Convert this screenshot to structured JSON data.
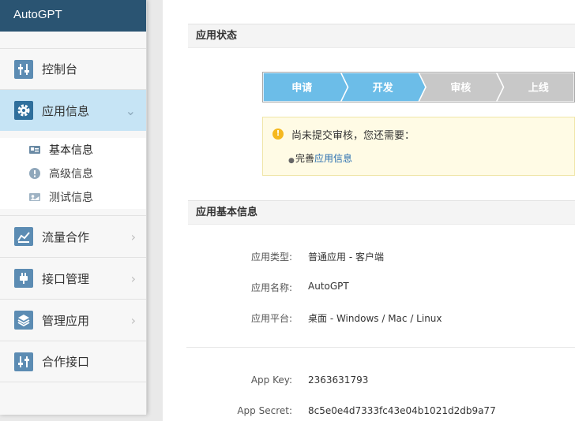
{
  "sidebar": {
    "brand": "AutoGPT",
    "items": [
      {
        "label": "控制台",
        "icon": "console-icon"
      },
      {
        "label": "应用信息",
        "icon": "gear-icon",
        "expanded": true
      },
      {
        "label": "流量合作",
        "icon": "chart-icon"
      },
      {
        "label": "接口管理",
        "icon": "plug-icon"
      },
      {
        "label": "管理应用",
        "icon": "layers-icon"
      },
      {
        "label": "合作接口",
        "icon": "sliders-icon"
      }
    ],
    "subitems": [
      {
        "label": "基本信息",
        "icon": "id-card-icon"
      },
      {
        "label": "高级信息",
        "icon": "info-icon"
      },
      {
        "label": "测试信息",
        "icon": "test-card-icon"
      }
    ]
  },
  "status": {
    "title": "应用状态",
    "steps": [
      "申请",
      "开发",
      "审核",
      "上线"
    ],
    "active_step_count": 2,
    "notice": {
      "title": "尚未提交审核，您还需要：",
      "prefix": "完善",
      "link": "应用信息"
    }
  },
  "basic": {
    "title": "应用基本信息",
    "rows": [
      {
        "label": "应用类型:",
        "value": "普通应用  -  客户端"
      },
      {
        "label": "应用名称:",
        "value": "AutoGPT"
      },
      {
        "label": "应用平台:",
        "value": "桌面  -  Windows / Mac / Linux"
      }
    ],
    "keys": [
      {
        "label": "App Key:",
        "value": "2363631793"
      },
      {
        "label": "App Secret:",
        "value": "8c5e0e4d7333fc43e04b1021d2db9a77"
      }
    ]
  },
  "colors": {
    "brand_bar": "#2a5472",
    "active_nav": "#c6e4f5",
    "icon_tile": "#5c8cb3",
    "step_active": "#6cbde8",
    "step_inactive": "#c8c8c8",
    "link": "#2a6fb0"
  }
}
